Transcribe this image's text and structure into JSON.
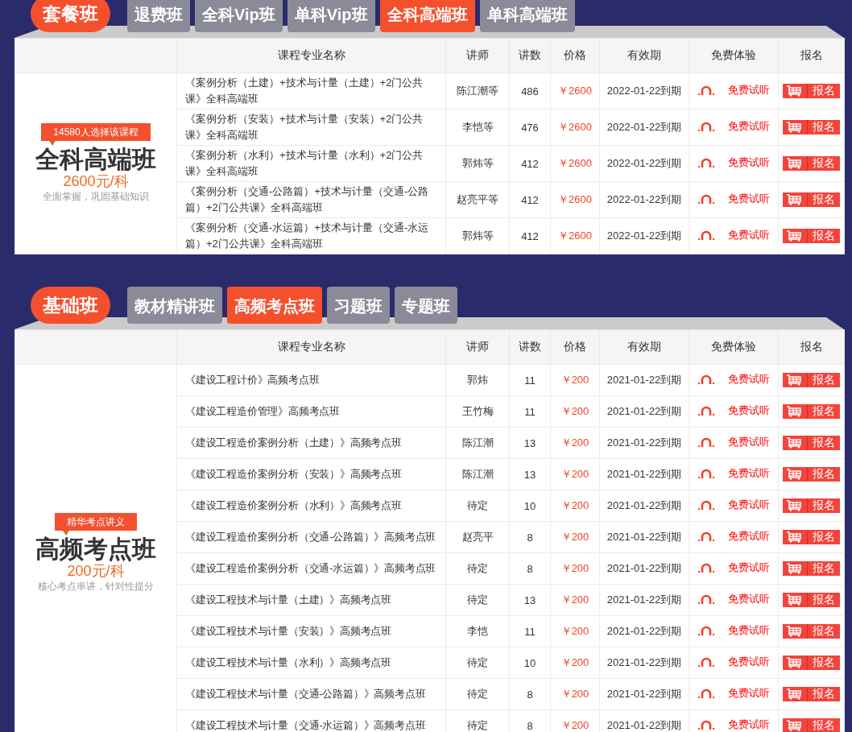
{
  "sections": [
    {
      "category": "套餐班",
      "tabs": [
        {
          "label": "退费班",
          "selected": false
        },
        {
          "label": "全科Vip班",
          "selected": false
        },
        {
          "label": "单科Vip班",
          "selected": false
        },
        {
          "label": "全科高端班",
          "selected": true
        },
        {
          "label": "单科高端班",
          "selected": false
        }
      ],
      "promo": {
        "badge": "14580人选择该课程",
        "title": "全科高端班",
        "price": "2600元/科",
        "subtitle": "全面掌握，巩固基础知识"
      },
      "columns": [
        "课程专业名称",
        "讲师",
        "讲数",
        "价格",
        "有效期",
        "免费体验",
        "报名"
      ],
      "rows": [
        {
          "name": "《案例分析（土建）+技术与计量（土建）+2门公共课》全科高端班",
          "teacher": "陈江潮等",
          "lessons": "486",
          "price": "￥2600",
          "expiry": "2022-01-22到期",
          "trial": "免费试听",
          "signup": "报名"
        },
        {
          "name": "《案例分析（安装）+技术与计量（安装）+2门公共课》全科高端班",
          "teacher": "李恺等",
          "lessons": "476",
          "price": "￥2600",
          "expiry": "2022-01-22到期",
          "trial": "免费试听",
          "signup": "报名"
        },
        {
          "name": "《案例分析（水利）+技术与计量（水利）+2门公共课》全科高端班",
          "teacher": "郭炜等",
          "lessons": "412",
          "price": "￥2600",
          "expiry": "2022-01-22到期",
          "trial": "免费试听",
          "signup": "报名"
        },
        {
          "name": "《案例分析（交通-公路篇）+技术与计量（交通-公路篇）+2门公共课》全科高端班",
          "teacher": "赵亮平等",
          "lessons": "412",
          "price": "￥2600",
          "expiry": "2022-01-22到期",
          "trial": "免费试听",
          "signup": "报名"
        },
        {
          "name": "《案例分析（交通-水运篇）+技术与计量（交通-水运篇）+2门公共课》全科高端班",
          "teacher": "郭炜等",
          "lessons": "412",
          "price": "￥2600",
          "expiry": "2022-01-22到期",
          "trial": "免费试听",
          "signup": "报名"
        }
      ]
    },
    {
      "category": "基础班",
      "tabs": [
        {
          "label": "教材精讲班",
          "selected": false
        },
        {
          "label": "高频考点班",
          "selected": true
        },
        {
          "label": "习题班",
          "selected": false
        },
        {
          "label": "专题班",
          "selected": false
        }
      ],
      "promo": {
        "badge": "精华考点讲义",
        "title": "高频考点班",
        "price": "200元/科",
        "subtitle": "核心考点串讲，针对性提分"
      },
      "columns": [
        "课程专业名称",
        "讲师",
        "讲数",
        "价格",
        "有效期",
        "免费体验",
        "报名"
      ],
      "rows": [
        {
          "name": "《建设工程计价》高频考点班",
          "teacher": "郭炜",
          "lessons": "11",
          "price": "￥200",
          "expiry": "2021-01-22到期",
          "trial": "免费试听",
          "signup": "报名"
        },
        {
          "name": "《建设工程造价管理》高频考点班",
          "teacher": "王竹梅",
          "lessons": "11",
          "price": "￥200",
          "expiry": "2021-01-22到期",
          "trial": "免费试听",
          "signup": "报名"
        },
        {
          "name": "《建设工程造价案例分析（土建）》高频考点班",
          "teacher": "陈江潮",
          "lessons": "13",
          "price": "￥200",
          "expiry": "2021-01-22到期",
          "trial": "免费试听",
          "signup": "报名"
        },
        {
          "name": "《建设工程造价案例分析（安装）》高频考点班",
          "teacher": "陈江潮",
          "lessons": "13",
          "price": "￥200",
          "expiry": "2021-01-22到期",
          "trial": "免费试听",
          "signup": "报名"
        },
        {
          "name": "《建设工程造价案例分析（水利）》高频考点班",
          "teacher": "待定",
          "lessons": "10",
          "price": "￥200",
          "expiry": "2021-01-22到期",
          "trial": "免费试听",
          "signup": "报名"
        },
        {
          "name": "《建设工程造价案例分析（交通-公路篇）》高频考点班",
          "teacher": "赵亮平",
          "lessons": "8",
          "price": "￥200",
          "expiry": "2021-01-22到期",
          "trial": "免费试听",
          "signup": "报名"
        },
        {
          "name": "《建设工程造价案例分析（交通-水运篇）》高频考点班",
          "teacher": "待定",
          "lessons": "8",
          "price": "￥200",
          "expiry": "2021-01-22到期",
          "trial": "免费试听",
          "signup": "报名"
        },
        {
          "name": "《建设工程技术与计量（土建）》高频考点班",
          "teacher": "待定",
          "lessons": "13",
          "price": "￥200",
          "expiry": "2021-01-22到期",
          "trial": "免费试听",
          "signup": "报名"
        },
        {
          "name": "《建设工程技术与计量（安装）》高频考点班",
          "teacher": "李恺",
          "lessons": "11",
          "price": "￥200",
          "expiry": "2021-01-22到期",
          "trial": "免费试听",
          "signup": "报名"
        },
        {
          "name": "《建设工程技术与计量（水利）》高频考点班",
          "teacher": "待定",
          "lessons": "10",
          "price": "￥200",
          "expiry": "2021-01-22到期",
          "trial": "免费试听",
          "signup": "报名"
        },
        {
          "name": "《建设工程技术与计量（交通-公路篇）》高频考点班",
          "teacher": "待定",
          "lessons": "8",
          "price": "￥200",
          "expiry": "2021-01-22到期",
          "trial": "免费试听",
          "signup": "报名"
        },
        {
          "name": "《建设工程技术与计量（交通-水运篇）》高频考点班",
          "teacher": "待定",
          "lessons": "8",
          "price": "￥200",
          "expiry": "2021-01-22到期",
          "trial": "免费试听",
          "signup": "报名"
        }
      ]
    }
  ]
}
